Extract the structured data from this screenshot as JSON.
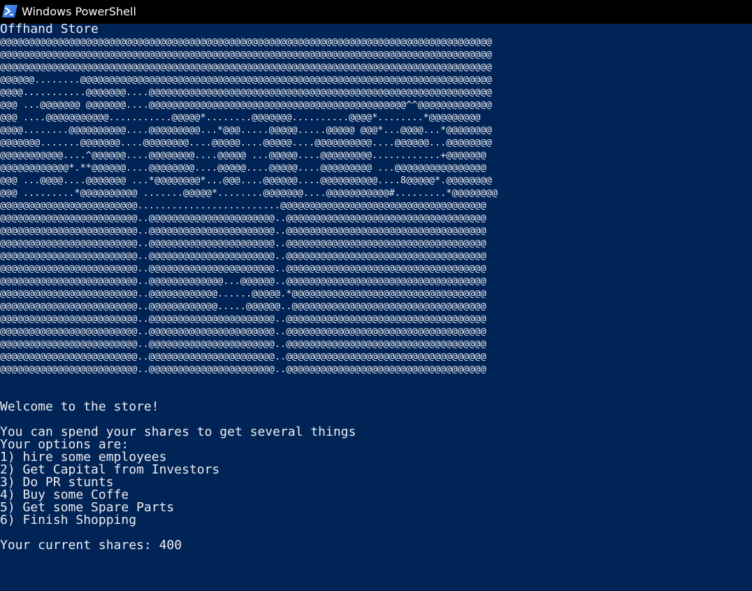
{
  "window": {
    "title": "Windows PowerShell",
    "icon": "powershell-icon"
  },
  "console": {
    "header": "Offhand Store",
    "art": [
      "@@@@@@@@@@@@@@@@@@@@@@@@@@@@@@@@@@@@@@@@@@@@@@@@@@@@@@@@@@@@@@@@@@@@@@@@@@@@@@@@@@@@@@",
      "@@@@@@@@@@@@@@@@@@@@@@@@@@@@@@@@@@@@@@@@@@@@@@@@@@@@@@@@@@@@@@@@@@@@@@@@@@@@@@@@@@@@@@",
      "@@@@@@@@@@@@@@@@@@@@@@@@@@@@@@@@@@@@@@@@@@@@@@@@@@@@@@@@@@@@@@@@@@@@@@@@@@@@@@@@@@@@@@",
      "@@@@@@........@@@@@@@@@@@@@@@@@@@@@@@@@@@@@@@@@@@@@@@@@@@@@@@@@@@@@@@@@@@@@@@@@@@@@@@@",
      "@@@@...........@@@@@@@....@@@@@@@@@@@@@@@@@@@@@@@@@@@@@@@@@@@@@@@@@@@@@@@@@@@@@@@@@@@@",
      "@@@ ...@@@@@@@ @@@@@@@....@@@@@@@@@@@@@@@@@@@@@@@@@@@@@@@@@@@@@@@@@@@@@^^@@@@@@@@@@@@@",
      "@@@ ....@@@@@@@@@@@...........@@@@@*........@@@@@@@..........@@@@*........*@@@@@@@@@",
      "@@@@........@@@@@@@@@@....@@@@@@@@@...*@@@.....@@@@@.....@@@@@ @@@*...@@@@...*@@@@@@@@",
      "@@@@@@@.......@@@@@@@....@@@@@@@@....@@@@@....@@@@@....@@@@@@@@@@....@@@@@@...@@@@@@@@",
      "@@@@@@@@@@@....^@@@@@@....@@@@@@@@....@@@@@ ...@@@@@....@@@@@@@@@............+@@@@@@@",
      "@@@@@@@@@@@@*.**@@@@@@....@@@@@@@@....@@@@@....@@@@@....@@@@@@@@@ ...@@@@@@@@@@@@@@@@",
      "@@@ ...@@@@....@@@@@@@ ...*@@@@@@@@*...@@@....@@@@@@....@@@@@@@@@@....8@@@@@*.@@@@@@@@",
      "@@@ .........*@@@@@@@@@@ .......@@@@@*........@@@@@@@....@@@@@@@@@@@#.........*@@@@@@@@",
      "@@@@@@@@@@@@@@@@@@@@@@@@.........................@@@@@@@@@@@@@@@@@@@@@@@@@@@@@@@@@@@@",
      "@@@@@@@@@@@@@@@@@@@@@@@@..@@@@@@@@@@@@@@@@@@@@@@..@@@@@@@@@@@@@@@@@@@@@@@@@@@@@@@@@@@",
      "@@@@@@@@@@@@@@@@@@@@@@@@..@@@@@@@@@@@@@@@@@@@@@@..@@@@@@@@@@@@@@@@@@@@@@@@@@@@@@@@@@@",
      "@@@@@@@@@@@@@@@@@@@@@@@@..@@@@@@@@@@@@@@@@@@@@@@..@@@@@@@@@@@@@@@@@@@@@@@@@@@@@@@@@@@",
      "@@@@@@@@@@@@@@@@@@@@@@@@..@@@@@@@@@@@@@@@@@@@@@@..@@@@@@@@@@@@@@@@@@@@@@@@@@@@@@@@@@@",
      "@@@@@@@@@@@@@@@@@@@@@@@@..@@@@@@@@@@@@@@@@@@@@@@..@@@@@@@@@@@@@@@@@@@@@@@@@@@@@@@@@@@",
      "@@@@@@@@@@@@@@@@@@@@@@@@..@@@@@@@@@@@@@...@@@@@@..@@@@@@@@@@@@@@@@@@@@@@@@@@@@@@@@@@@",
      "@@@@@@@@@@@@@@@@@@@@@@@@..@@@@@@@@@@@@......@@@@@.*@@@@@@@@@@@@@@@@@@@@@@@@@@@@@@@@@@",
      "@@@@@@@@@@@@@@@@@@@@@@@@..@@@@@@@@@@@@.....@@@@@@..@@@@@@@@@@@@@@@@@@@@@@@@@@@@@@@@@@",
      "@@@@@@@@@@@@@@@@@@@@@@@@..@@@@@@@@@@@@@@@@@@@@@@..@@@@@@@@@@@@@@@@@@@@@@@@@@@@@@@@@@@",
      "@@@@@@@@@@@@@@@@@@@@@@@@..@@@@@@@@@@@@@@@@@@@@@@..@@@@@@@@@@@@@@@@@@@@@@@@@@@@@@@@@@@",
      "@@@@@@@@@@@@@@@@@@@@@@@@..@@@@@@@@@@@@@@@@@@@@@@..@@@@@@@@@@@@@@@@@@@@@@@@@@@@@@@@@@@",
      "@@@@@@@@@@@@@@@@@@@@@@@@..@@@@@@@@@@@@@@@@@@@@@@..@@@@@@@@@@@@@@@@@@@@@@@@@@@@@@@@@@@",
      "@@@@@@@@@@@@@@@@@@@@@@@@..@@@@@@@@@@@@@@@@@@@@@@..@@@@@@@@@@@@@@@@@@@@@@@@@@@@@@@@@@@"
    ],
    "welcome": "Welcome to the store!",
    "intro": "You can spend your shares to get several things",
    "options_header": "Your options are:",
    "options": [
      "1) hire some employees",
      "2) Get Capital from Investors",
      "3) Do PR stunts",
      "4) Buy some Coffe",
      "5) Get some Spare Parts",
      "6) Finish Shopping"
    ],
    "shares_line": "Your current shares: 400"
  },
  "colors": {
    "background": "#012456",
    "text": "#eeedf0",
    "titlebar": "#000000"
  }
}
